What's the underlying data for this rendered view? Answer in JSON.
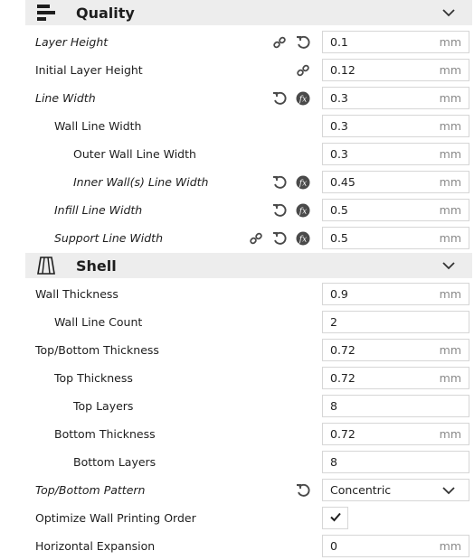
{
  "sections": {
    "quality": {
      "title": "Quality",
      "icon": "quality-icon"
    },
    "shell": {
      "title": "Shell",
      "icon": "shell-icon"
    }
  },
  "quality_rows": [
    {
      "label": "Layer Height",
      "value": "0.1",
      "unit": "mm",
      "italic": true,
      "controls": [
        "link",
        "reset"
      ]
    },
    {
      "label": "Initial Layer Height",
      "value": "0.12",
      "unit": "mm",
      "italic": false,
      "controls": [
        "link"
      ]
    },
    {
      "label": "Line Width",
      "value": "0.3",
      "unit": "mm",
      "italic": true,
      "controls": [
        "reset",
        "function"
      ]
    },
    {
      "label": "Wall Line Width",
      "value": "0.3",
      "unit": "mm",
      "italic": false,
      "controls": []
    },
    {
      "label": "Outer Wall Line Width",
      "value": "0.3",
      "unit": "mm",
      "italic": false,
      "controls": []
    },
    {
      "label": "Inner Wall(s) Line Width",
      "value": "0.45",
      "unit": "mm",
      "italic": true,
      "controls": [
        "reset",
        "function"
      ]
    },
    {
      "label": "Infill Line Width",
      "value": "0.5",
      "unit": "mm",
      "italic": true,
      "controls": [
        "reset",
        "function"
      ]
    },
    {
      "label": "Support Line Width",
      "value": "0.5",
      "unit": "mm",
      "italic": true,
      "controls": [
        "link",
        "reset",
        "function"
      ]
    }
  ],
  "shell_rows": [
    {
      "label": "Wall Thickness",
      "value": "0.9",
      "unit": "mm",
      "italic": false,
      "controls": []
    },
    {
      "label": "Wall Line Count",
      "value": "2",
      "unit": "",
      "italic": false,
      "controls": []
    },
    {
      "label": "Top/Bottom Thickness",
      "value": "0.72",
      "unit": "mm",
      "italic": false,
      "controls": []
    },
    {
      "label": "Top Thickness",
      "value": "0.72",
      "unit": "mm",
      "italic": false,
      "controls": []
    },
    {
      "label": "Top Layers",
      "value": "8",
      "unit": "",
      "italic": false,
      "controls": []
    },
    {
      "label": "Bottom Thickness",
      "value": "0.72",
      "unit": "mm",
      "italic": false,
      "controls": []
    },
    {
      "label": "Bottom Layers",
      "value": "8",
      "unit": "",
      "italic": false,
      "controls": []
    },
    {
      "label": "Top/Bottom Pattern",
      "value": "Concentric",
      "unit": "",
      "italic": true,
      "controls": [
        "reset"
      ],
      "dropdown": true
    },
    {
      "label": "Optimize Wall Printing Order",
      "value": "",
      "unit": "",
      "italic": false,
      "controls": [],
      "checkbox": true,
      "checked": true
    },
    {
      "label": "Horizontal Expansion",
      "value": "0",
      "unit": "mm",
      "italic": false,
      "controls": []
    }
  ],
  "colors": {
    "section_bg": "#ededed",
    "icon": "#4a4a4a",
    "border": "#d6d6d6",
    "unit": "#8a8a8a"
  }
}
